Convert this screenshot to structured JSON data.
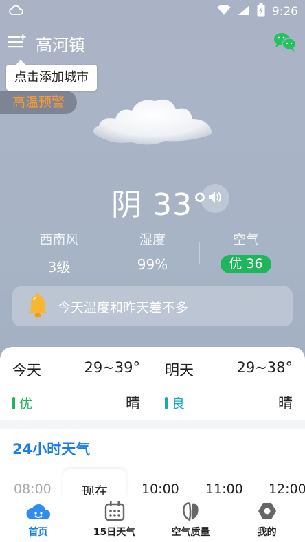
{
  "status_bar": {
    "time": "9:26",
    "icons": [
      "cloud-notification-icon",
      "wifi-icon",
      "signal-icon",
      "battery-charging-icon"
    ]
  },
  "header": {
    "menu_icon": "add-city-menu-icon",
    "city": "高河镇",
    "share_icon": "wechat-icon"
  },
  "tooltip": {
    "text": "点击添加城市"
  },
  "alert": {
    "label": "高温预警",
    "color": "#ff9a2e"
  },
  "current": {
    "condition_temp": "阴 33°",
    "speaker_icon": "speaker-icon"
  },
  "stats": [
    {
      "label": "西南风",
      "value": "3级"
    },
    {
      "label": "湿度",
      "value": "99%"
    },
    {
      "label": "空气",
      "value": "优 36",
      "badge_color": "#1fb55a"
    }
  ],
  "tip": {
    "icon": "bell-icon",
    "text": "今天温度和昨天差不多"
  },
  "days": [
    {
      "name": "今天",
      "range": "29~39°",
      "air": "优",
      "air_color": "#1fb55a",
      "condition": "晴"
    },
    {
      "name": "明天",
      "range": "29~38°",
      "air": "良",
      "air_color": "#1aa7b8",
      "condition": "晴"
    }
  ],
  "hourly": {
    "title": "24小时天气",
    "hours": [
      "08:00",
      "现在",
      "10:00",
      "11:00",
      "12:00"
    ]
  },
  "tabs": [
    {
      "label": "首页",
      "icon": "home-cloud-icon",
      "active": true
    },
    {
      "label": "15日天气",
      "icon": "calendar-icon",
      "active": false
    },
    {
      "label": "空气质量",
      "icon": "leaf-icon",
      "active": false
    },
    {
      "label": "我的",
      "icon": "hexagon-profile-icon",
      "active": false
    }
  ],
  "colors": {
    "accent": "#1b7de8",
    "sky": "#a9b4c6"
  }
}
